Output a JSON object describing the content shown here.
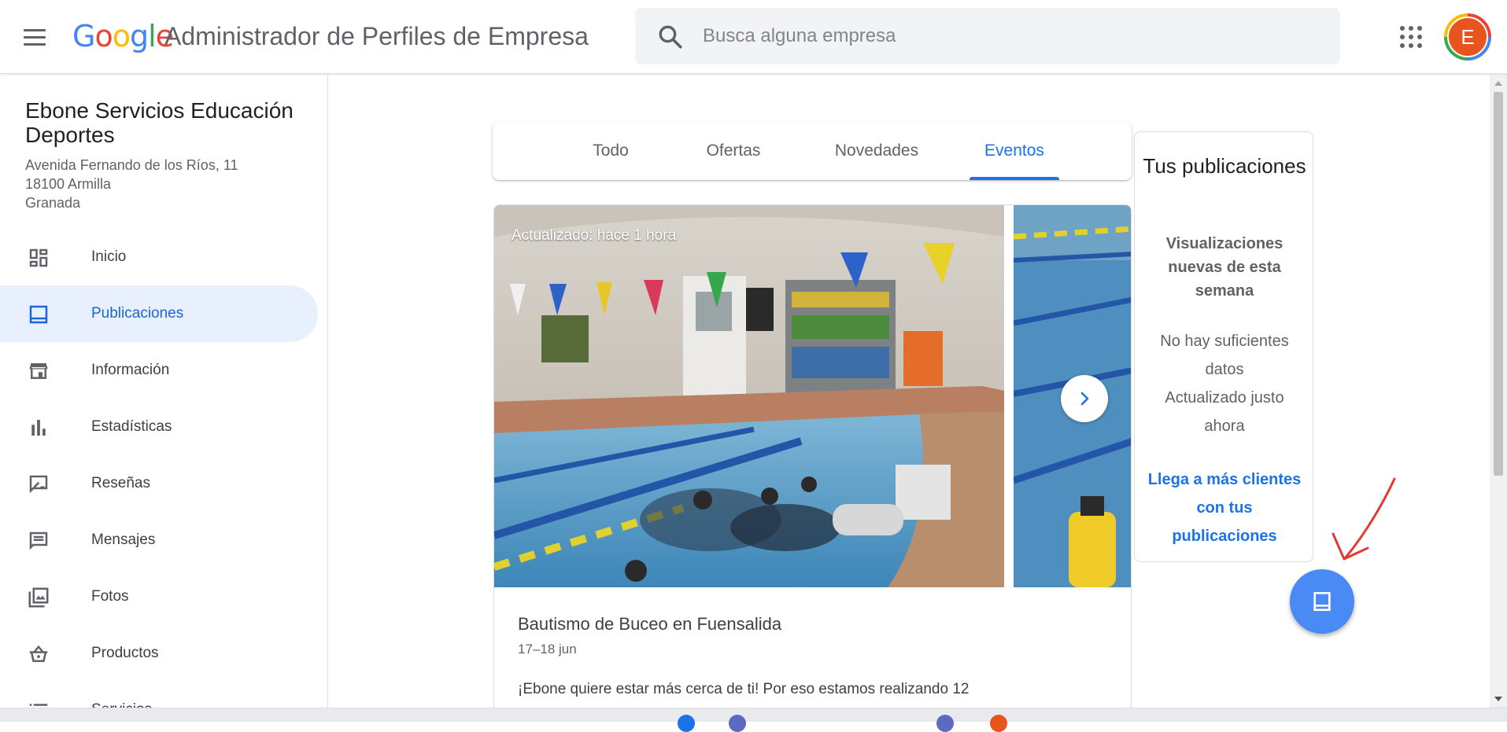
{
  "header": {
    "logo": [
      "G",
      "o",
      "o",
      "g",
      "l",
      "e"
    ],
    "app_title": "Administrador de Perfiles de Empresa",
    "search_placeholder": "Busca alguna empresa",
    "avatar_letter": "E"
  },
  "business": {
    "name": "Ebone Servicios Educación Deportes",
    "address_line1": "Avenida Fernando de los Ríos, 11",
    "address_line2": "18100 Armilla",
    "address_line3": "Granada"
  },
  "sidebar": {
    "items": [
      {
        "label": "Inicio",
        "icon": "dashboard-icon",
        "active": false
      },
      {
        "label": "Publicaciones",
        "icon": "posts-icon",
        "active": true
      },
      {
        "label": "Información",
        "icon": "store-icon",
        "active": false
      },
      {
        "label": "Estadísticas",
        "icon": "bar-chart-icon",
        "active": false
      },
      {
        "label": "Reseñas",
        "icon": "rate-review-icon",
        "active": false
      },
      {
        "label": "Mensajes",
        "icon": "message-icon",
        "active": false
      },
      {
        "label": "Fotos",
        "icon": "photos-icon",
        "active": false
      },
      {
        "label": "Productos",
        "icon": "basket-icon",
        "active": false
      },
      {
        "label": "Servicios",
        "icon": "list-icon",
        "active": false
      }
    ]
  },
  "tabs": [
    {
      "label": "Todo",
      "active": false
    },
    {
      "label": "Ofertas",
      "active": false
    },
    {
      "label": "Novedades",
      "active": false
    },
    {
      "label": "Eventos",
      "active": true
    }
  ],
  "post": {
    "updated": "Actualizado: hace 1 hora",
    "title": "Bautismo de Buceo en Fuensalida",
    "date": "17–18 jun",
    "body": "¡Ebone quiere estar más cerca de ti! Por eso estamos realizando 12"
  },
  "stats": {
    "title": "Tus publicaciones",
    "subtitle": "Visualizaciones nuevas de esta semana",
    "no_data": "No hay suficientes datos",
    "updated": "Actualizado justo ahora",
    "link": "Llega a más clientes con tus publicaciones"
  },
  "colors": {
    "accent": "#1a73e8",
    "active_bg": "#e8f0fe",
    "fab": "#4a8af4",
    "annotation_arrow": "#e53935"
  }
}
